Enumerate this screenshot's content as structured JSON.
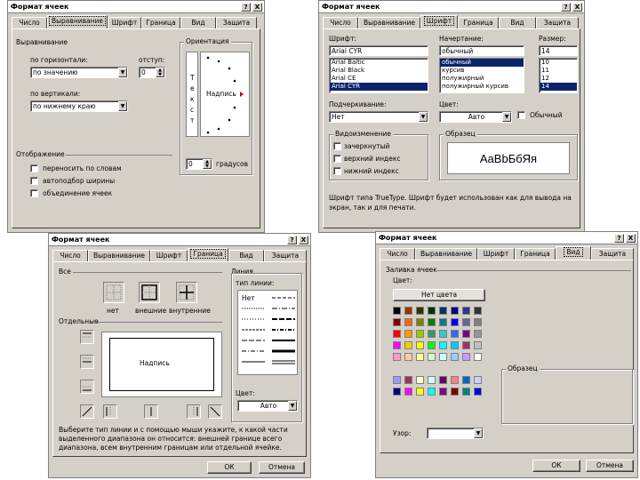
{
  "window_title": "Формат ячеек",
  "title_buttons": {
    "help": "?",
    "close": "X"
  },
  "tabs": [
    "Число",
    "Выравнивание",
    "Шрифт",
    "Граница",
    "Вид",
    "Защита"
  ],
  "align": {
    "group_title": "Выравнивание",
    "horizontal_label": "по горизонтали:",
    "horizontal_value": "по значению",
    "indent_label": "отступ:",
    "indent_value": "0",
    "vertical_label": "по вертикали:",
    "vertical_value": "по нижнему краю",
    "orientation_title": "Ориентация",
    "orientation_vertical_letters": [
      "Т",
      "е",
      "к",
      "с",
      "т"
    ],
    "orientation_caption": "Надпись",
    "degrees_value": "0",
    "degrees_label": "градусов",
    "display_title": "Отображение",
    "checks": [
      "переносить по словам",
      "автоподбор ширины",
      "объединение ячеек"
    ]
  },
  "font": {
    "font_label": "Шрифт:",
    "font_value": "Arial CYR",
    "font_list": [
      "Arial Baltic",
      "Arial Black",
      "Arial CE",
      "Arial CYR"
    ],
    "style_label": "Начертание:",
    "style_value": "обычный",
    "style_list": [
      "обычный",
      "курсив",
      "полужирный",
      "полужирный курсив"
    ],
    "size_label": "Размер:",
    "size_value": "14",
    "size_list": [
      "10",
      "11",
      "12",
      "14"
    ],
    "underline_label": "Подчеркивание:",
    "underline_value": "Нет",
    "color_label": "Цвет:",
    "color_value": "Авто",
    "normal_label": "Обычный",
    "modification_title": "Видоизменение",
    "modification_checks": [
      "зачеркнутый",
      "верхний индекс",
      "нижний индекс"
    ],
    "sample_title": "Образец",
    "sample_text": "AaBbБбЯя",
    "note": "Шрифт типа TrueType. Шрифт будет использован как для вывода на экран, так и для печати."
  },
  "border": {
    "all_title": "Все",
    "presets": [
      "нет",
      "внешние",
      "внутренние"
    ],
    "separate_title": "Отдельные",
    "sample_text": "Надпись",
    "line_title": "Линия",
    "type_label": "тип линии:",
    "none_label": "Нет",
    "color_label": "Цвет:",
    "color_value": "Авто",
    "note": "Выберите тип линии и с помощью мыши укажите, к какой части выделенного диапазона он относится: внешней границе всего диапазона, всем внутренним границам или отдельной ячейке.",
    "ok": "ОК",
    "cancel": "Отмена"
  },
  "view": {
    "shading_title": "Заливка ячеек",
    "color_label": "Цвет:",
    "no_color": "Нет цвета",
    "pattern_label": "Узор:",
    "sample_title": "Образец",
    "ok": "ОК",
    "cancel": "Отмена",
    "palette": [
      [
        "#000000",
        "#993300",
        "#333300",
        "#003300",
        "#003366",
        "#000080",
        "#333399",
        "#333333"
      ],
      [
        "#800000",
        "#ff6600",
        "#808000",
        "#008000",
        "#008080",
        "#0000ff",
        "#666699",
        "#808080"
      ],
      [
        "#ff0000",
        "#ff9900",
        "#99cc00",
        "#339966",
        "#33cccc",
        "#3366ff",
        "#800080",
        "#969696"
      ],
      [
        "#ff00ff",
        "#ffcc00",
        "#ffff00",
        "#00ff00",
        "#00ffff",
        "#00ccff",
        "#993366",
        "#c0c0c0"
      ],
      [
        "#ff99cc",
        "#ffcc99",
        "#ffff99",
        "#ccffcc",
        "#ccffff",
        "#99ccff",
        "#cc99ff",
        "#ffffff"
      ]
    ],
    "palette_extra": [
      [
        "#9999ff",
        "#993366",
        "#ffffcc",
        "#ccffff",
        "#660066",
        "#ff8080",
        "#0066cc",
        "#ccccff"
      ],
      [
        "#000080",
        "#ff00ff",
        "#ffff00",
        "#00ffff",
        "#800080",
        "#800000",
        "#008080",
        "#0000ff"
      ]
    ]
  }
}
